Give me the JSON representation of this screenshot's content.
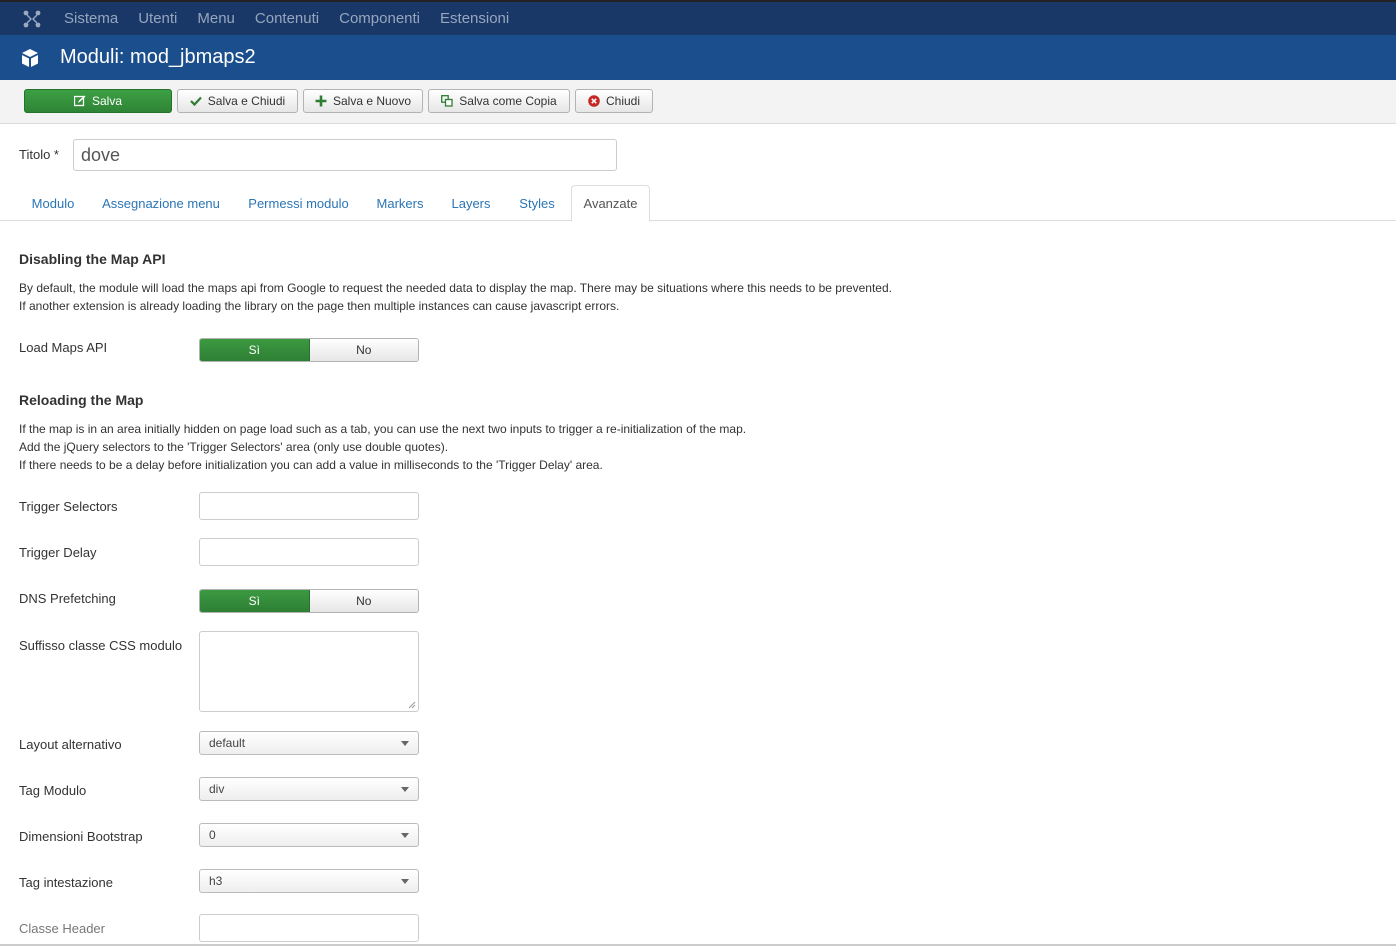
{
  "nav": {
    "logo_icon": "joomla-logo-icon",
    "items": [
      "Sistema",
      "Utenti",
      "Menu",
      "Contenuti",
      "Componenti",
      "Estensioni"
    ]
  },
  "header": {
    "icon": "cube-icon",
    "title": "Moduli: mod_jbmaps2"
  },
  "toolbar": {
    "save": "Salva",
    "save_close": "Salva e Chiudi",
    "save_new": "Salva e Nuovo",
    "save_copy": "Salva come Copia",
    "close": "Chiudi"
  },
  "form": {
    "title_label": "Titolo *",
    "title_value": "dove"
  },
  "tabs": [
    "Modulo",
    "Assegnazione menu",
    "Permessi modulo",
    "Markers",
    "Layers",
    "Styles",
    "Avanzate"
  ],
  "active_tab": "Avanzate",
  "section1": {
    "title": "Disabling the Map API",
    "line1": "By default, the module will load the maps api from Google to request the needed data to display the map. There may be situations where this needs to be prevented.",
    "line2": "If another extension is already loading the library on the page then multiple instances can cause javascript errors."
  },
  "load_maps_api": {
    "label": "Load Maps API",
    "yes": "Sì",
    "no": "No",
    "value": "Sì"
  },
  "section2": {
    "title": "Reloading the Map",
    "line1": "If the map is in an area initially hidden on page load such as a tab, you can use the next two inputs to trigger a re-initialization of the map.",
    "line2": "Add the jQuery selectors to the 'Trigger Selectors' area (only use double quotes).",
    "line3": "If there needs to be a delay before initialization you can add a value in milliseconds to the 'Trigger Delay' area."
  },
  "trigger_selectors": {
    "label": "Trigger Selectors",
    "value": ""
  },
  "trigger_delay": {
    "label": "Trigger Delay",
    "value": ""
  },
  "dns_prefetching": {
    "label": "DNS Prefetching",
    "yes": "Sì",
    "no": "No",
    "value": "Sì"
  },
  "css_suffix": {
    "label": "Suffisso classe CSS modulo",
    "value": ""
  },
  "alt_layout": {
    "label": "Layout alternativo",
    "value": "default"
  },
  "module_tag": {
    "label": "Tag Modulo",
    "value": "div"
  },
  "bootstrap_size": {
    "label": "Dimensioni Bootstrap",
    "value": "0"
  },
  "header_tag": {
    "label": "Tag intestazione",
    "value": "h3"
  },
  "header_class": {
    "label": "Classe Header",
    "value": ""
  },
  "colors": {
    "nav_bg": "#1a3867",
    "header_bg": "#1a4e8c",
    "success": "#2f8436",
    "link": "#2a75b5"
  }
}
